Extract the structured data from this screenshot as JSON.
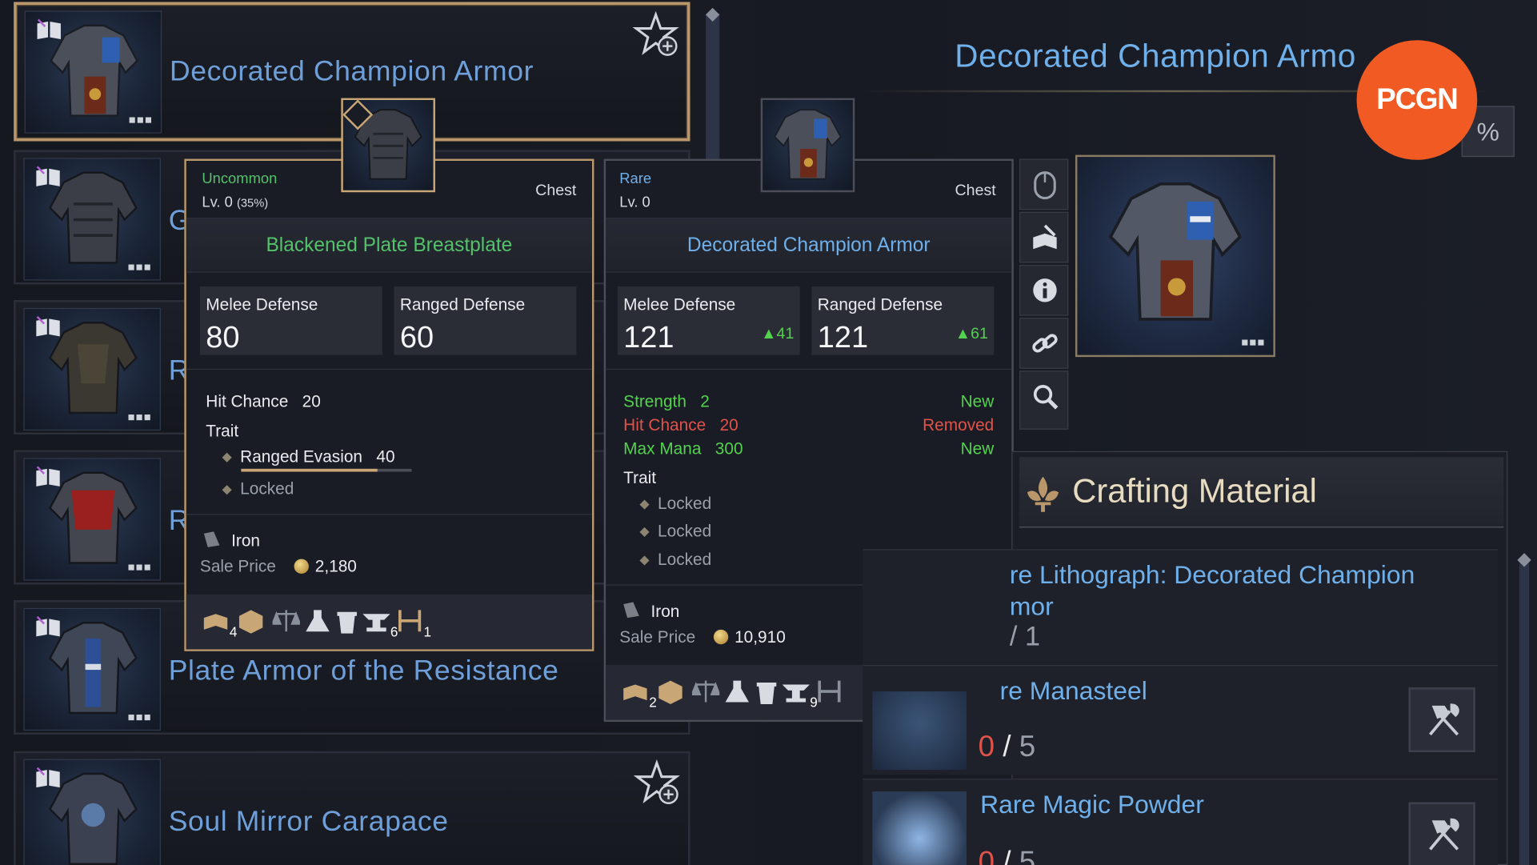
{
  "list": {
    "items": [
      {
        "name": "Decorated Champion Armor"
      },
      {
        "name": "G"
      },
      {
        "name": "R"
      },
      {
        "name": "R"
      },
      {
        "name": "Plate Armor of the Resistance"
      },
      {
        "name": "Soul Mirror Carapace"
      }
    ],
    "dots": "■■■"
  },
  "tooltip_current": {
    "rarity": "Uncommon",
    "level": "Lv. 0",
    "level_pct": "(35%)",
    "slot": "Chest",
    "title": "Blackened Plate Breastplate",
    "melee_label": "Melee Defense",
    "melee_value": "80",
    "ranged_label": "Ranged Defense",
    "ranged_value": "60",
    "hit_label": "Hit Chance",
    "hit_value": "20",
    "trait_label": "Trait",
    "trait1_label": "Ranged Evasion",
    "trait1_value": "40",
    "trait1_progress": 0.8,
    "trait2": "Locked",
    "material": "Iron",
    "sale_label": "Sale Price",
    "sale_value": "2,180",
    "icon_counts": [
      "4",
      "",
      "",
      "",
      "",
      "6",
      "1"
    ],
    "colors": {
      "rarity": "#53c26a",
      "title": "#53c26a"
    }
  },
  "tooltip_compare": {
    "rarity": "Rare",
    "level": "Lv. 0",
    "slot": "Chest",
    "title": "Decorated Champion Armor",
    "melee_label": "Melee Defense",
    "melee_value": "121",
    "melee_diff": "▲41",
    "ranged_label": "Ranged Defense",
    "ranged_value": "121",
    "ranged_diff": "▲61",
    "changes": [
      {
        "label": "Strength",
        "value": "2",
        "status": "New"
      },
      {
        "label": "Hit Chance",
        "value": "20",
        "status": "Removed"
      },
      {
        "label": "Max Mana",
        "value": "300",
        "status": "New"
      }
    ],
    "trait_label": "Trait",
    "traits": [
      "Locked",
      "Locked",
      "Locked"
    ],
    "material": "Iron",
    "sale_label": "Sale Price",
    "sale_value": "10,910",
    "icon_counts": [
      "2",
      "",
      "",
      "",
      "",
      "9",
      ""
    ],
    "colors": {
      "rarity": "#6fb0ea",
      "title": "#6fb0ea"
    }
  },
  "detail": {
    "title": "Decorated Champion Armo",
    "percent_button": "%",
    "side_buttons": [
      "mouse-icon",
      "craft-book-icon",
      "info-icon",
      "link-icon",
      "magnify-icon"
    ]
  },
  "crafting": {
    "title": "Crafting Material",
    "materials": [
      {
        "line1": "re Lithograph: Decorated Champion",
        "line2": "mor",
        "count": "/ 1"
      },
      {
        "name": "re Manasteel",
        "have": "0",
        "sep": "/",
        "need": "5"
      },
      {
        "name": "Rare Magic Powder",
        "have": "0",
        "sep": "/",
        "need": "5"
      }
    ]
  },
  "watermark": {
    "text": "PCGN"
  }
}
